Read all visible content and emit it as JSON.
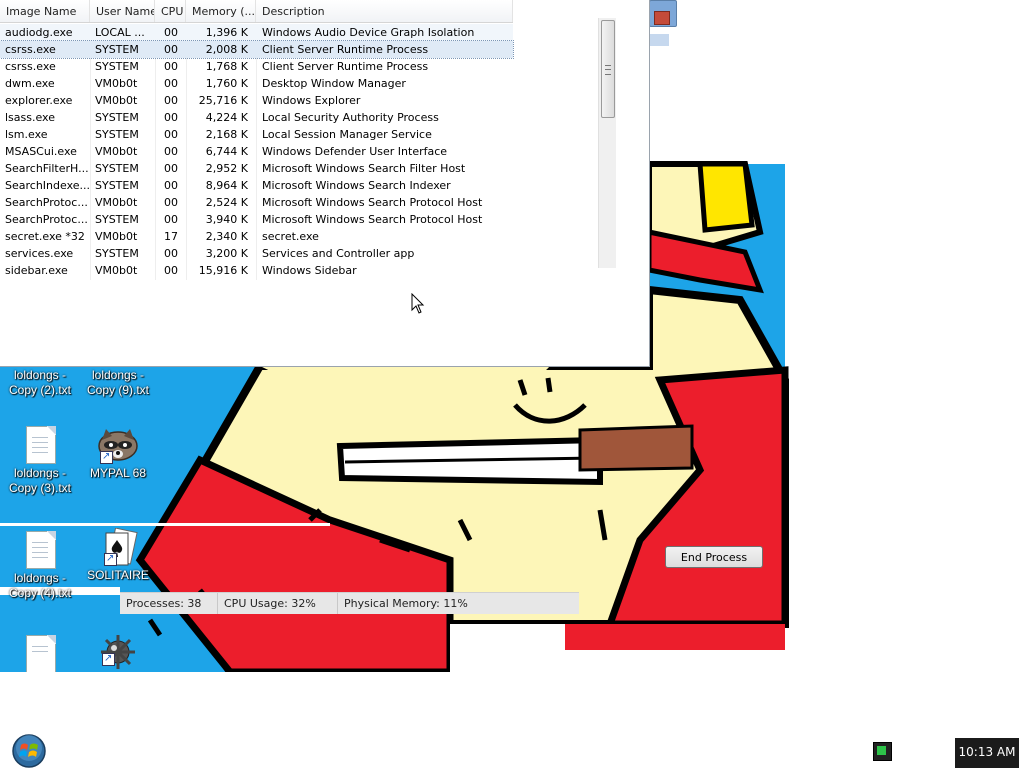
{
  "process_list": {
    "columns": [
      "Image Name",
      "User Name",
      "CPU",
      "Memory (...",
      "Description"
    ],
    "rows": [
      {
        "image": "audiodg.exe",
        "user": "LOCAL ...",
        "cpu": "00",
        "memory": "1,396 K",
        "description": "Windows Audio Device Graph Isolation"
      },
      {
        "image": "csrss.exe",
        "user": "SYSTEM",
        "cpu": "00",
        "memory": "2,008 K",
        "description": "Client Server Runtime Process"
      },
      {
        "image": "csrss.exe",
        "user": "SYSTEM",
        "cpu": "00",
        "memory": "1,768 K",
        "description": "Client Server Runtime Process"
      },
      {
        "image": "dwm.exe",
        "user": "VM0b0t",
        "cpu": "00",
        "memory": "1,760 K",
        "description": "Desktop Window Manager"
      },
      {
        "image": "explorer.exe",
        "user": "VM0b0t",
        "cpu": "00",
        "memory": "25,716 K",
        "description": "Windows Explorer"
      },
      {
        "image": "lsass.exe",
        "user": "SYSTEM",
        "cpu": "00",
        "memory": "4,224 K",
        "description": "Local Security Authority Process"
      },
      {
        "image": "lsm.exe",
        "user": "SYSTEM",
        "cpu": "00",
        "memory": "2,168 K",
        "description": "Local Session Manager Service"
      },
      {
        "image": "MSASCui.exe",
        "user": "VM0b0t",
        "cpu": "00",
        "memory": "6,744 K",
        "description": "Windows Defender User Interface"
      },
      {
        "image": "SearchFilterH...",
        "user": "SYSTEM",
        "cpu": "00",
        "memory": "2,952 K",
        "description": "Microsoft Windows Search Filter Host"
      },
      {
        "image": "SearchIndexe...",
        "user": "SYSTEM",
        "cpu": "00",
        "memory": "8,964 K",
        "description": "Microsoft Windows Search Indexer"
      },
      {
        "image": "SearchProtoc...",
        "user": "VM0b0t",
        "cpu": "00",
        "memory": "2,524 K",
        "description": "Microsoft Windows Search Protocol Host"
      },
      {
        "image": "SearchProtoc...",
        "user": "SYSTEM",
        "cpu": "00",
        "memory": "3,940 K",
        "description": "Microsoft Windows Search Protocol Host"
      },
      {
        "image": "secret.exe *32",
        "user": "VM0b0t",
        "cpu": "17",
        "memory": "2,340 K",
        "description": "secret.exe"
      },
      {
        "image": "services.exe",
        "user": "SYSTEM",
        "cpu": "00",
        "memory": "3,200 K",
        "description": "Services and Controller app"
      },
      {
        "image": "sidebar.exe",
        "user": "VM0b0t",
        "cpu": "00",
        "memory": "15,916 K",
        "description": "Windows Sidebar"
      }
    ],
    "selected_row": 1
  },
  "desktop_icons": [
    {
      "line1": "loldongs -",
      "line2": "Copy (2).txt",
      "icon": "text-file-icon"
    },
    {
      "line1": "loldongs -",
      "line2": "Copy (9).txt",
      "icon": "text-file-icon"
    },
    {
      "line1": "loldongs -",
      "line2": "Copy (3).txt",
      "icon": "text-file-icon"
    },
    {
      "line1": "MYPAL 68",
      "line2": "",
      "icon": "raccoon-browser-icon"
    },
    {
      "line1": "loldongs -",
      "line2": "Copy (4).txt",
      "icon": "text-file-icon"
    },
    {
      "line1": "SOLITAIRE",
      "line2": "",
      "icon": "solitaire-cards-icon"
    },
    {
      "line1": "",
      "line2": "",
      "icon": "text-file-icon"
    },
    {
      "line1": "",
      "line2": "",
      "icon": "minesweeper-mine-icon"
    }
  ],
  "end_process_label": "End Process",
  "status": {
    "processes": "Processes: 38",
    "cpu": "CPU Usage: 32%",
    "memory": "Physical Memory: 11%"
  },
  "taskbar": {
    "clock": "10:13 AM",
    "start_icon": "windows-start-orb-icon",
    "tray_icon": "monitor-tray-icon"
  },
  "colors": {
    "wallpaper_sky": "#1da4e8",
    "wallpaper_red": "#ec1e2c",
    "wallpaper_skin": "#fdf6b8",
    "selection": "#dfeaf6"
  }
}
